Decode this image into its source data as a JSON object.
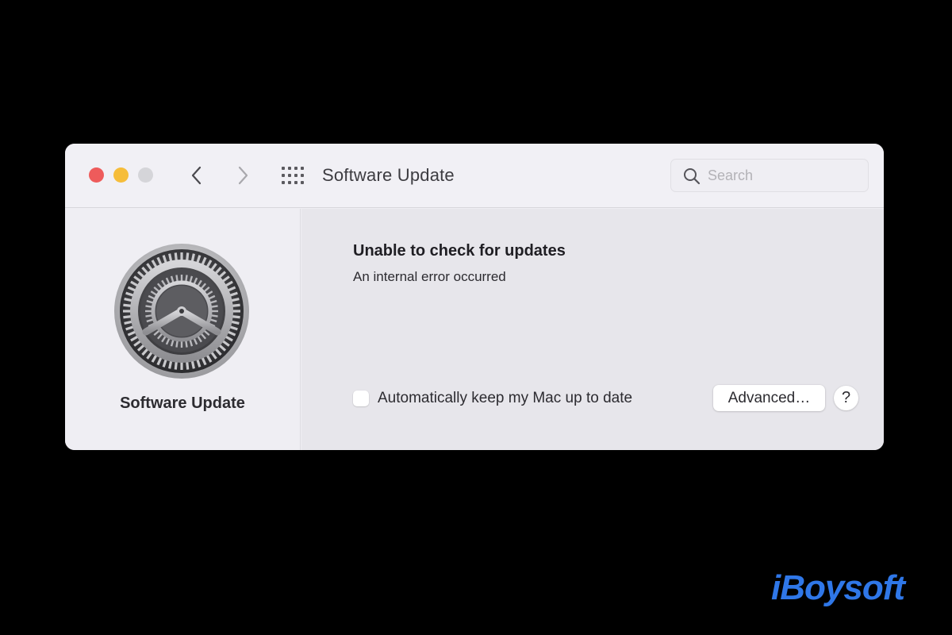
{
  "window": {
    "title": "Software Update",
    "search": {
      "placeholder": "Search",
      "value": ""
    }
  },
  "sidebar": {
    "icon": "software-update-gear-icon",
    "label": "Software Update"
  },
  "main": {
    "status_title": "Unable to check for updates",
    "status_message": "An internal error occurred",
    "auto_update": {
      "label": "Automatically keep my Mac up to date",
      "checked": false
    },
    "advanced_label": "Advanced…",
    "help_label": "?"
  },
  "colors": {
    "close": "#ee5b5b",
    "minimize": "#f6bd3a",
    "zoom": "#d5d5d9",
    "watermark": "#2f77e8"
  },
  "watermark": "iBoysoft"
}
